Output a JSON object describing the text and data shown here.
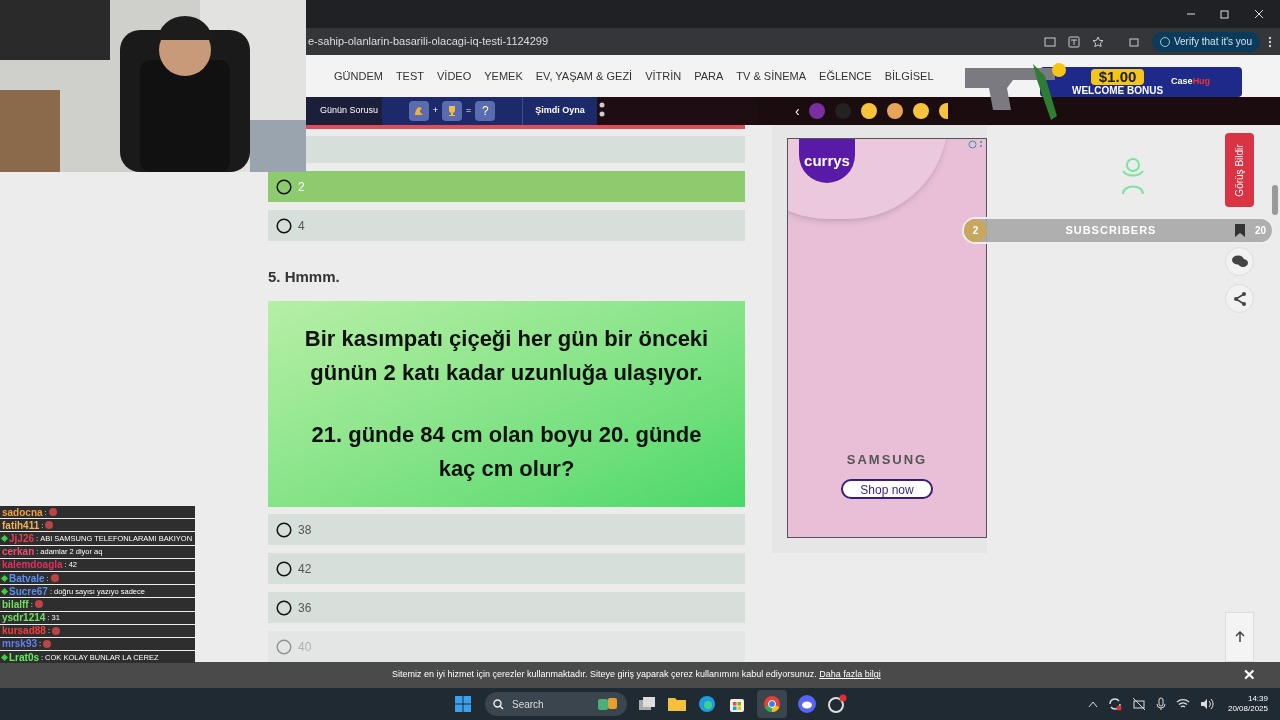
{
  "browser": {
    "url": "e-sahip-olanlarin-basarili-olacagi-iq-testi-1124299",
    "verify_button": "Verify that it's you"
  },
  "nav": {
    "items": [
      "GÜNDEM",
      "TEST",
      "VİDEO",
      "YEMEK",
      "EV, YAŞAM & GEZİ",
      "VİTRİN",
      "PARA",
      "TV & SİNEMA",
      "EĞLENCE",
      "BİLGİSEL"
    ]
  },
  "promo_banner": {
    "amount": "$1.00",
    "text": "WELCOME BONUS",
    "brand": "Case",
    "brand_accent": "Hug"
  },
  "subbar": {
    "question_of_day": "Günün Sorusu",
    "plus": "+",
    "equals": "=",
    "question_mark": "?",
    "play": "Şimdi Oyna",
    "prev": "‹"
  },
  "quiz": {
    "prev_options": [
      {
        "label": "2",
        "selected": true
      },
      {
        "label": "4",
        "selected": false
      }
    ],
    "question": {
      "title": "5. Hmmm.",
      "lines": [
        "Bir kasımpatı çiçeği her gün bir önceki günün 2 katı kadar uzunluğa ulaşıyor.",
        "21. günde 84 cm olan boyu 20. günde kaç cm olur?"
      ]
    },
    "options": [
      {
        "label": "38",
        "selected": false
      },
      {
        "label": "42",
        "selected": false
      },
      {
        "label": "36",
        "selected": false
      },
      {
        "label": "40",
        "selected": false
      }
    ]
  },
  "ad": {
    "brand": "currys",
    "maker": "SAMSUNG",
    "button": "Shop now"
  },
  "subscribers": {
    "count": "2",
    "label": "SUBSCRIBERS",
    "goal": "20"
  },
  "feedback": "Görüş Bildir",
  "cookie": {
    "text": "Sitemiz en iyi hizmet için çerezler kullanmaktadır. Siteye giriş yaparak çerez kullanımını kabul ediyorsunuz.",
    "link": "Daha fazla bilgi",
    "close": "✕"
  },
  "taskbar": {
    "search": "Search",
    "time": "14:39",
    "date": "20/08/2025"
  },
  "chat": [
    {
      "user": "sadocna",
      "color": "#f0a040",
      "badge": false,
      "separator": ":",
      "kind": "emote"
    },
    {
      "user": "fatih411",
      "color": "#f0b060",
      "badge": false,
      "separator": ":",
      "kind": "emote"
    },
    {
      "user": "JjJ26",
      "color": "#e04050",
      "badge": true,
      "separator": ":",
      "kind": "text",
      "text": "ABI SAMSUNG TELEFONLARAMI BAKIYON"
    },
    {
      "user": "cerkan",
      "color": "#f05070",
      "badge": false,
      "separator": ":",
      "kind": "text",
      "text": "adamlar 2 diyor aq"
    },
    {
      "user": "kalemdoagla",
      "color": "#e03060",
      "badge": false,
      "separator": ":",
      "kind": "text",
      "text": "42"
    },
    {
      "user": "Batvale",
      "color": "#5a90f0",
      "badge": true,
      "separator": ":",
      "kind": "emote"
    },
    {
      "user": "Sucre67",
      "color": "#5a90f0",
      "badge": true,
      "separator": ":",
      "kind": "text",
      "text": "doğru sayısı yazıyo sadece"
    },
    {
      "user": "bilalff",
      "color": "#70e060",
      "badge": false,
      "separator": ":",
      "kind": "emote"
    },
    {
      "user": "ysdr1214",
      "color": "#70e060",
      "badge": false,
      "separator": ":",
      "kind": "text",
      "text": "31"
    },
    {
      "user": "kursad88",
      "color": "#f04040",
      "badge": false,
      "separator": ":",
      "kind": "emote"
    },
    {
      "user": "mrsk93",
      "color": "#6080f0",
      "badge": false,
      "separator": ":",
      "kind": "emote"
    },
    {
      "user": "Lrat0s",
      "color": "#60f060",
      "badge": true,
      "separator": ":",
      "kind": "text",
      "text": "COK KOLAY BUNLAR LA CEREZ"
    }
  ]
}
